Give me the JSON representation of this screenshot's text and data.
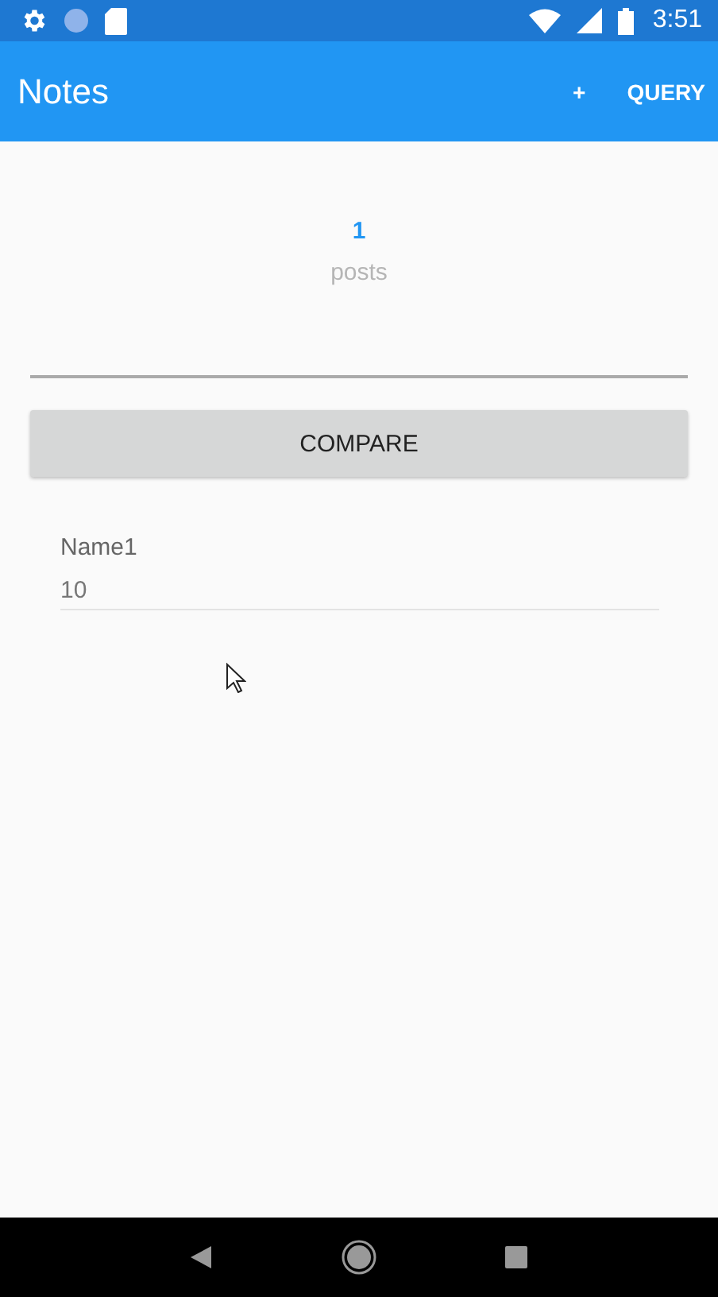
{
  "status_bar": {
    "time": "3:51"
  },
  "app_bar": {
    "title": "Notes",
    "actions": [
      "+",
      "QUERY"
    ]
  },
  "stats": {
    "count": "1",
    "label": "posts"
  },
  "compare_button": "COMPARE",
  "items": [
    {
      "name": "Name1",
      "value": "10"
    }
  ]
}
